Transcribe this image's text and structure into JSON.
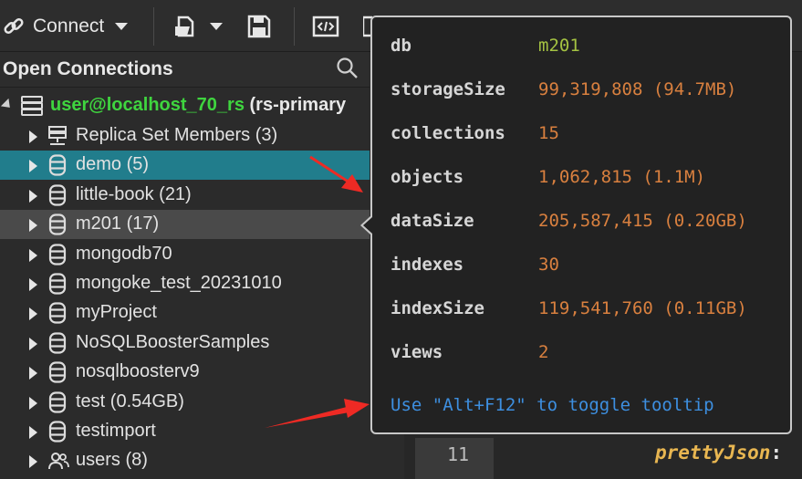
{
  "toolbar": {
    "connect_label": "Connect"
  },
  "panel": {
    "title": "Open Connections"
  },
  "tree": {
    "root": {
      "user": "user@localhost_70_rs",
      "suffix": "(rs-primary"
    },
    "items": [
      {
        "label": "Replica Set Members (3)",
        "icon": "server-icon"
      },
      {
        "label": "demo (5)",
        "icon": "database-icon"
      },
      {
        "label": "little-book (21)",
        "icon": "database-icon"
      },
      {
        "label": "m201 (17)",
        "icon": "database-icon"
      },
      {
        "label": "mongodb70",
        "icon": "database-icon"
      },
      {
        "label": "mongoke_test_20231010",
        "icon": "database-icon"
      },
      {
        "label": "myProject",
        "icon": "database-icon"
      },
      {
        "label": "NoSQLBoosterSamples",
        "icon": "database-icon"
      },
      {
        "label": "nosqlboosterv9",
        "icon": "database-icon"
      },
      {
        "label": "test (0.54GB)",
        "icon": "database-icon"
      },
      {
        "label": "testimport",
        "icon": "database-icon"
      },
      {
        "label": "users (8)",
        "icon": "users-icon"
      }
    ]
  },
  "tooltip": {
    "rows": [
      {
        "key": "db",
        "value": "m201"
      },
      {
        "key": "storageSize",
        "value": "99,319,808 (94.7MB)"
      },
      {
        "key": "collections",
        "value": "15"
      },
      {
        "key": "objects",
        "value": "1,062,815 (1.1M)"
      },
      {
        "key": "dataSize",
        "value": "205,587,415 (0.20GB)"
      },
      {
        "key": "indexes",
        "value": "30"
      },
      {
        "key": "indexSize",
        "value": "119,541,760 (0.11GB)"
      },
      {
        "key": "views",
        "value": "2"
      }
    ],
    "hint": "Use \"Alt+F12\" to toggle tooltip"
  },
  "editor": {
    "line_number": "11",
    "code_text": "prettyJson",
    "code_colon": ":"
  },
  "colors": {
    "selected_row": "#217d8c",
    "hover_row": "#4a4a4a",
    "value": "#d9803f",
    "db_value": "#a4c242",
    "hint": "#3d8fe0",
    "user": "#3fd53f"
  }
}
